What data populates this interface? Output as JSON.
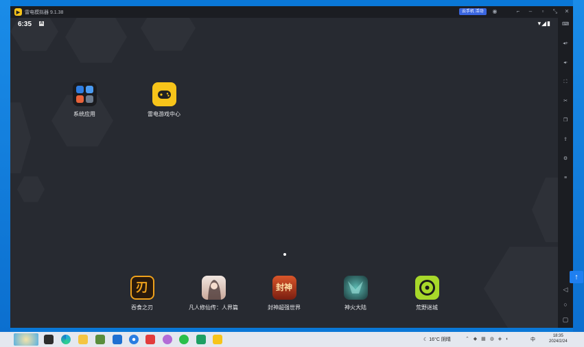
{
  "window": {
    "title": "雷电模拟器 9.1.38",
    "badge": "云手机 活动"
  },
  "status": {
    "time": "6:35",
    "a_icon": "A"
  },
  "home_apps": [
    {
      "label": "系统应用",
      "icon": "folder-icon"
    },
    {
      "label": "雷电游戏中心",
      "icon": "gamepad-icon"
    }
  ],
  "dock_apps": [
    {
      "label": "吞食之刃",
      "icon": "blade-game-icon",
      "color": "#f0a21b"
    },
    {
      "label": "凡人修仙传：人界篇",
      "icon": "immortal-game-icon",
      "color": "#e6d6cf"
    },
    {
      "label": "封神超强世界",
      "icon": "fengshen-game-icon",
      "color": "#b23a1f"
    },
    {
      "label": "神火大陆",
      "icon": "fire-land-game-icon",
      "color": "#245a5c"
    },
    {
      "label": "荒野迷城",
      "icon": "wild-city-game-icon",
      "color": "#a7d82a"
    }
  ],
  "sidebar": [
    {
      "icon": "keyboard-icon",
      "glyph": "⌨"
    },
    {
      "icon": "volume-up-icon",
      "glyph": "◂+"
    },
    {
      "icon": "volume-down-icon",
      "glyph": "◂-"
    },
    {
      "icon": "screenshot-icon",
      "glyph": "⛶"
    },
    {
      "icon": "scissors-icon",
      "glyph": "✂"
    },
    {
      "icon": "multi-instance-icon",
      "glyph": "❐"
    },
    {
      "icon": "install-apk-icon",
      "glyph": "⇪"
    },
    {
      "icon": "settings-icon",
      "glyph": "⚙"
    },
    {
      "icon": "more-icon",
      "glyph": "≡"
    }
  ],
  "nav": {
    "back": "◁",
    "home": "○",
    "recent": "▢"
  },
  "taskbar": {
    "weather": "16°C 阴晴",
    "time": "18:35",
    "date": "2024/2/24",
    "lang": "中",
    "float_glyph": "↑"
  },
  "colors": {
    "accent": "#1e7ff0",
    "brand": "#f7c41a"
  }
}
